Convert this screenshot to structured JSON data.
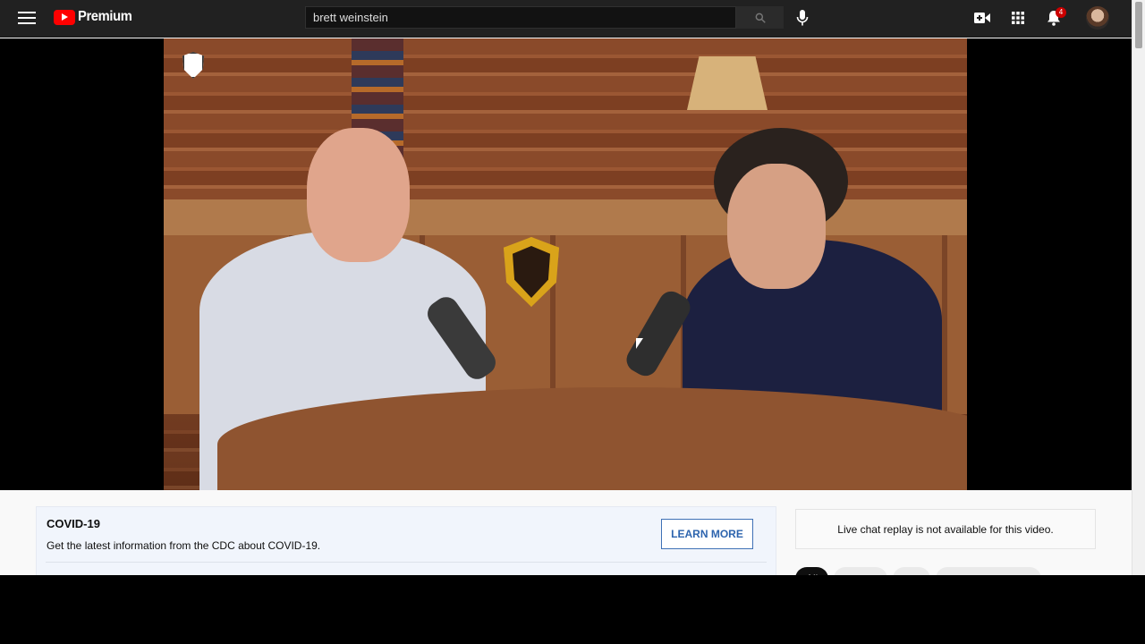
{
  "masthead": {
    "logo_text": "Premium",
    "search_value": "brett weinstein",
    "notification_count": "4",
    "icons": [
      "menu-icon",
      "youtube-logo",
      "search-icon",
      "mic-icon",
      "create-video-icon",
      "apps-grid-icon",
      "bell-icon",
      "avatar"
    ]
  },
  "player": {
    "watermark": "horse-shield-logo"
  },
  "covid_panel": {
    "title": "COVID-19",
    "description": "Get the latest information from the CDC about COVID-19.",
    "button_label": "LEARN MORE"
  },
  "chat": {
    "message": "Live chat replay is not available for this video."
  },
  "chips": [
    {
      "label": "All",
      "active": true
    },
    {
      "label": "",
      "active": false
    },
    {
      "label": "",
      "active": false
    },
    {
      "label": "",
      "active": false
    }
  ],
  "colors": {
    "masthead_bg": "#212121",
    "brand_red": "#ff0000",
    "badge_red": "#cc0000",
    "learn_more_blue": "#2d64ae",
    "covid_bg": "#f1f5fc"
  }
}
